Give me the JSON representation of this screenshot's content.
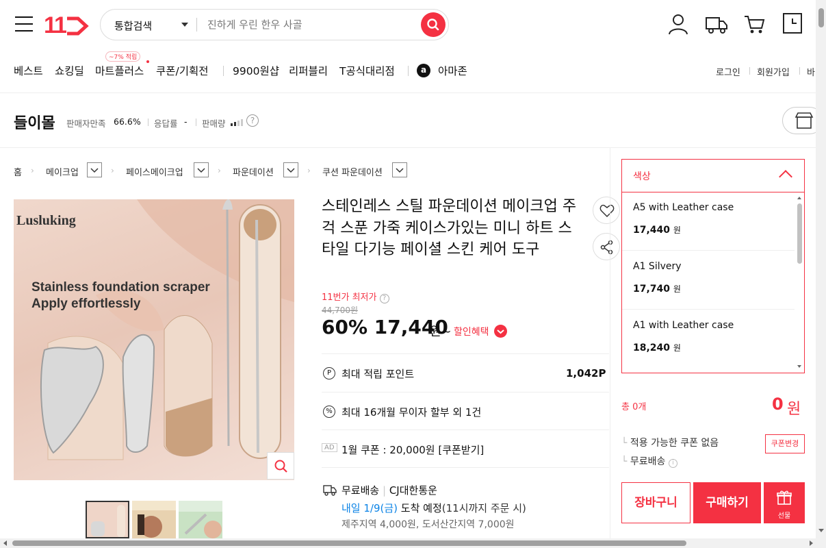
{
  "header": {
    "logo": "11",
    "search_scope": "통합검색",
    "search_placeholder": "진하게 우린 한우 사골",
    "icons": [
      "user-icon",
      "truck-icon",
      "cart-icon",
      "clock-icon"
    ]
  },
  "nav": {
    "items": [
      "베스트",
      "쇼킹딜",
      "마트플러스",
      "쿠폰/기획전",
      "9900원샵",
      "리퍼블리",
      "T공식대리점",
      "아마존"
    ],
    "mart_badge": "~7% 적립",
    "amazon_logo": "a",
    "util_links": [
      "로그인",
      "회원가입",
      "바"
    ]
  },
  "seller": {
    "name": "들이몰",
    "satisfaction_label": "판매자만족",
    "satisfaction_value": "66.6%",
    "response_label": "응답률",
    "response_value": "-",
    "sales_label": "판매량",
    "help": "?"
  },
  "breadcrumb": [
    "홈",
    "메이크업",
    "페이스메이크업",
    "파운데이션",
    "쿠션 파운데이션"
  ],
  "product": {
    "image_brand": "Lusluking",
    "image_caption_1": "Stainless foundation scraper",
    "image_caption_2": "Apply effortlessly",
    "title": "스테인레스 스틸 파운데이션 메이크업 주걱 스푼 가죽 케이스가있는 미니 하트 스타일 다기능 페이셜 스킨 케어 도구",
    "lowest_tag": "11번가 최저가",
    "original_price": "44,700원",
    "discount_price": "60% 17,440",
    "price_unit": "원~",
    "benefit": "할인혜택",
    "points_label": "최대 적립 포인트",
    "points_value": "1,042P",
    "installment": "최대 16개월 무이자 할부 외 1건",
    "ad_badge": "AD",
    "coupon": "1월 쿠폰 : 20,000원 [쿠폰받기]",
    "shipping": "무료배송",
    "courier": "CJ대한통운",
    "delivery_date": "내일 1/9(금)",
    "delivery_suffix": "도착 예정",
    "delivery_note": "(11시까지 주문 시)",
    "extra_shipping": "제주지역 4,000원, 도서산간지역 7,000원"
  },
  "options": {
    "header": "색상",
    "items": [
      {
        "name": "A5 with Leather case",
        "price": "17,440",
        "unit": "원"
      },
      {
        "name": "A1 Silvery",
        "price": "17,740",
        "unit": "원"
      },
      {
        "name": "A1 with Leather case",
        "price": "18,240",
        "unit": "원"
      }
    ]
  },
  "order": {
    "total_count": "총 0개",
    "total_price": "0",
    "total_unit": "원",
    "no_coupon": "적용 가능한 쿠폰 없음",
    "coupon_change": "쿠폰변경",
    "free_shipping": "무료배송",
    "cart": "장바구니",
    "buy": "구매하기",
    "gift": "선물"
  },
  "colors": {
    "accent": "#f43142"
  }
}
